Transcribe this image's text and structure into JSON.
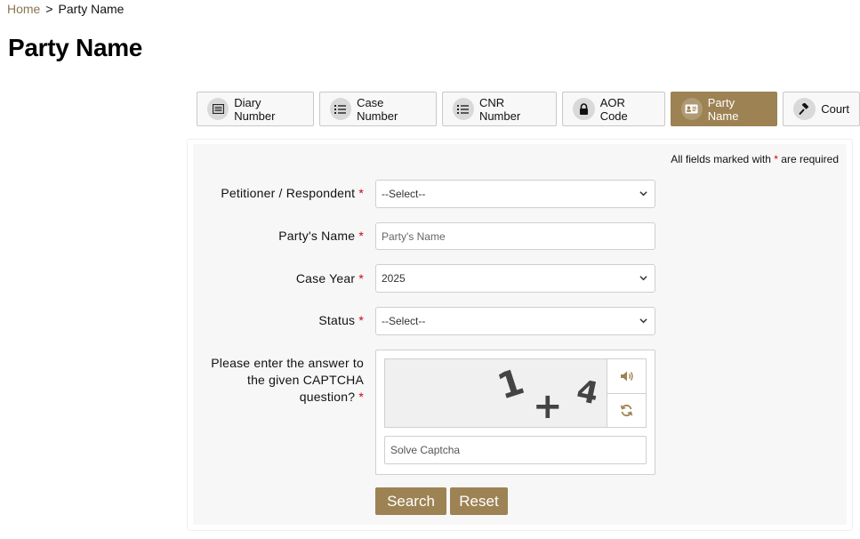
{
  "breadcrumb": {
    "home": "Home",
    "separator": ">",
    "current": "Party Name"
  },
  "page_title": "Party Name",
  "tabs": [
    {
      "label": "Diary Number",
      "icon": "card-icon",
      "active": false
    },
    {
      "label": "Case Number",
      "icon": "list-icon",
      "active": false
    },
    {
      "label": "CNR Number",
      "icon": "list-icon",
      "active": false
    },
    {
      "label": "AOR Code",
      "icon": "lock-icon",
      "active": false
    },
    {
      "label": "Party Name",
      "icon": "id-card-icon",
      "active": true
    },
    {
      "label": "Court",
      "icon": "gavel-icon",
      "active": false
    }
  ],
  "form": {
    "required_note_prefix": "All fields marked with",
    "required_star": "*",
    "required_note_suffix": "are required",
    "petitioner_label": "Petitioner / Respondent",
    "petitioner_value": "--Select--",
    "party_name_label": "Party's Name",
    "party_name_placeholder": "Party's Name",
    "case_year_label": "Case Year",
    "case_year_value": "2025",
    "status_label": "Status",
    "status_value": "--Select--",
    "captcha_label_line1": "Please enter the answer to",
    "captcha_label_line2": "the given CAPTCHA",
    "captcha_label_line3": "question?",
    "captcha_text_a": "1",
    "captcha_text_op": "+",
    "captcha_text_b": "4",
    "captcha_placeholder": "Solve Captcha",
    "search_label": "Search",
    "reset_label": "Reset"
  },
  "colors": {
    "accent": "#9d8253",
    "link": "#8b7650",
    "required": "#d0021b"
  }
}
